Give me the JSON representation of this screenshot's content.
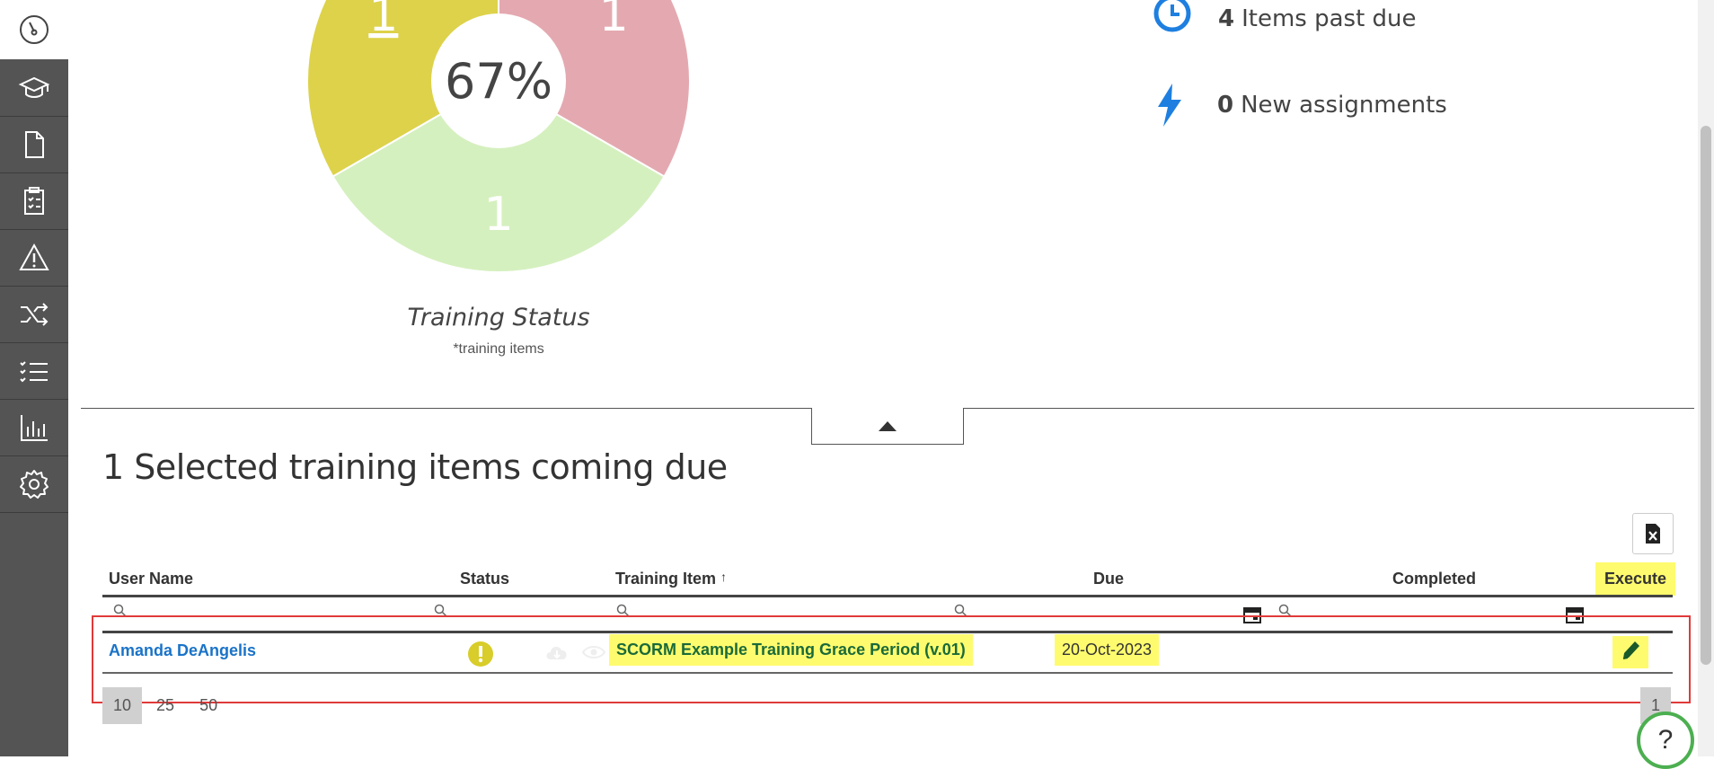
{
  "sidebar": {
    "items": [
      {
        "icon": "speedometer-icon"
      },
      {
        "icon": "graduation-cap-icon"
      },
      {
        "icon": "document-icon"
      },
      {
        "icon": "clipboard-checklist-icon"
      },
      {
        "icon": "warning-icon"
      },
      {
        "icon": "shuffle-icon"
      },
      {
        "icon": "checklist-icon"
      },
      {
        "icon": "bar-chart-icon"
      },
      {
        "icon": "gear-icon"
      }
    ]
  },
  "chart_data": {
    "type": "pie",
    "title": "Training Status",
    "subtitle": "*training items",
    "center_label": "67%",
    "slices": [
      {
        "label": "1",
        "value": 1,
        "color": "#ddd24a"
      },
      {
        "label": "1",
        "value": 1,
        "color": "#e4a9b0"
      },
      {
        "label": "1",
        "value": 1,
        "color": "#d5f0bf"
      }
    ]
  },
  "stats": {
    "past_due": {
      "count": "4",
      "label": "Items past due"
    },
    "new_assignments": {
      "count": "0",
      "label": "New assignments"
    }
  },
  "section": {
    "title": "1 Selected training items coming due"
  },
  "table": {
    "headers": {
      "user_name": "User Name",
      "status": "Status",
      "training_item": "Training Item",
      "sort_arrow": "↑",
      "due": "Due",
      "completed": "Completed",
      "execute": "Execute"
    },
    "rows": [
      {
        "user_name": "Amanda DeAngelis",
        "status_icon": "exclamation-icon",
        "training_item": "SCORM Example Training Grace Period (v.01)",
        "due": "20-Oct-2023",
        "completed": ""
      }
    ]
  },
  "pagination": {
    "page_sizes": [
      "10",
      "25",
      "50"
    ],
    "active_size": "10",
    "current_page": "1"
  },
  "help": {
    "label": "?"
  },
  "colors": {
    "sidebar_bg": "#545454",
    "highlight": "#fffb6e",
    "link": "#1a73c8",
    "accent_blue": "#1e7fe0",
    "red_box": "#e03a3a"
  }
}
